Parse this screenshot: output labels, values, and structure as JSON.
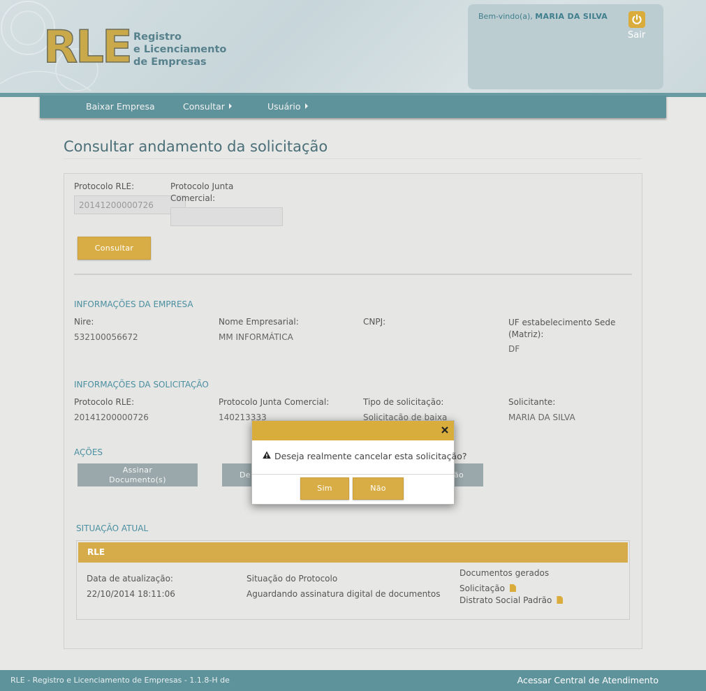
{
  "app": {
    "logo": "RLE",
    "logo_subtitle": [
      "Registro",
      "e Licenciamento",
      "de Empresas"
    ]
  },
  "user": {
    "welcome_prefix": "Bem-vindo(a),",
    "name": "MARIA DA SILVA",
    "logout_label": "Sair"
  },
  "nav": {
    "items": [
      {
        "label": "Baixar Empresa",
        "has_submenu": false
      },
      {
        "label": "Consultar",
        "has_submenu": true
      },
      {
        "label": "Usuário",
        "has_submenu": true
      }
    ]
  },
  "page": {
    "title": "Consultar andamento da solicitação"
  },
  "search": {
    "protocolo_rle_label": "Protocolo RLE:",
    "protocolo_rle_value": "20141200000726",
    "protocolo_junta_label_1": "Protocolo Junta",
    "protocolo_junta_label_2": "Comercial:",
    "protocolo_junta_value": "",
    "consultar_label": "Consultar"
  },
  "empresa": {
    "section_title": "INFORMAÇÕES DA EMPRESA",
    "nire_label": "Nire:",
    "nire_value": "532100056672",
    "nome_label": "Nome Empresarial:",
    "nome_value": "MM INFORMÁTICA",
    "cnpj_label": "CNPJ:",
    "cnpj_value": "",
    "uf_label_1": "UF estabelecimento Sede",
    "uf_label_2": "(Matriz):",
    "uf_value": "DF"
  },
  "solicitacao": {
    "section_title": "INFORMAÇÕES DA SOLICITAÇÃO",
    "protocolo_rle_label": "Protocolo RLE:",
    "protocolo_rle_value": "20141200000726",
    "protocolo_junta_label": "Protocolo Junta Comercial:",
    "protocolo_junta_value": "140213333",
    "tipo_label": "Tipo de solicitação:",
    "tipo_value": "Solicitação de baixa",
    "solicitante_label": "Solicitante:",
    "solicitante_value": "MARIA DA SILVA"
  },
  "acoes": {
    "section_title": "AÇÕES",
    "assinar_line1": "Assinar",
    "assinar_line2": "Documento(s)",
    "btn2_partial": "De",
    "btn3_partial": "ão"
  },
  "situacao": {
    "section_title": "SITUAÇÃO ATUAL",
    "box_title": "RLE",
    "data_label": "Data de atualização:",
    "data_value": "22/10/2014 18:11:06",
    "situacao_label": "Situação do Protocolo",
    "situacao_value": "Aguardando assinatura digital de documentos",
    "docs_label": "Documentos gerados",
    "docs": [
      "Solicitação",
      "Distrato Social Padrão"
    ]
  },
  "modal": {
    "message": "Deseja realmente cancelar esta solicitação?",
    "yes_label": "Sim",
    "no_label": "Não"
  },
  "footer": {
    "version_text": "RLE - Registro e Licenciamento de Empresas - 1.1.8-H de",
    "help_link": "Acessar Central de Atendimento"
  },
  "colors": {
    "accent_gold": "#d9ad45",
    "nav_teal": "#5f939c",
    "section_blue": "#4a8fa0"
  }
}
